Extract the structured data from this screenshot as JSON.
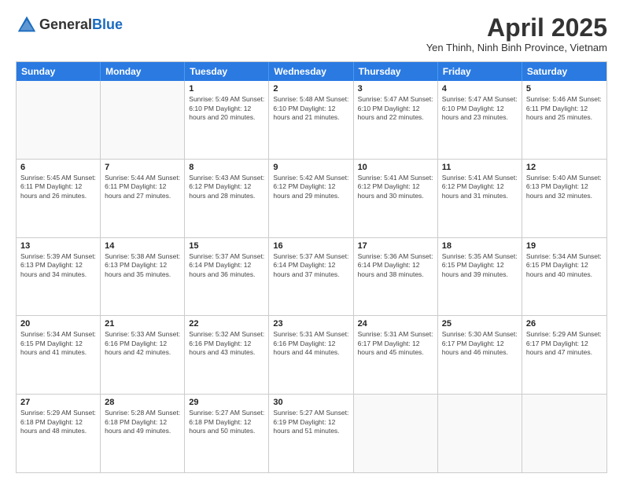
{
  "header": {
    "logo_line1": "General",
    "logo_line2": "Blue",
    "title": "April 2025",
    "location": "Yen Thinh, Ninh Binh Province, Vietnam"
  },
  "days_of_week": [
    "Sunday",
    "Monday",
    "Tuesday",
    "Wednesday",
    "Thursday",
    "Friday",
    "Saturday"
  ],
  "weeks": [
    [
      {
        "day": "",
        "info": ""
      },
      {
        "day": "",
        "info": ""
      },
      {
        "day": "1",
        "info": "Sunrise: 5:49 AM\nSunset: 6:10 PM\nDaylight: 12 hours and 20 minutes."
      },
      {
        "day": "2",
        "info": "Sunrise: 5:48 AM\nSunset: 6:10 PM\nDaylight: 12 hours and 21 minutes."
      },
      {
        "day": "3",
        "info": "Sunrise: 5:47 AM\nSunset: 6:10 PM\nDaylight: 12 hours and 22 minutes."
      },
      {
        "day": "4",
        "info": "Sunrise: 5:47 AM\nSunset: 6:10 PM\nDaylight: 12 hours and 23 minutes."
      },
      {
        "day": "5",
        "info": "Sunrise: 5:46 AM\nSunset: 6:11 PM\nDaylight: 12 hours and 25 minutes."
      }
    ],
    [
      {
        "day": "6",
        "info": "Sunrise: 5:45 AM\nSunset: 6:11 PM\nDaylight: 12 hours and 26 minutes."
      },
      {
        "day": "7",
        "info": "Sunrise: 5:44 AM\nSunset: 6:11 PM\nDaylight: 12 hours and 27 minutes."
      },
      {
        "day": "8",
        "info": "Sunrise: 5:43 AM\nSunset: 6:12 PM\nDaylight: 12 hours and 28 minutes."
      },
      {
        "day": "9",
        "info": "Sunrise: 5:42 AM\nSunset: 6:12 PM\nDaylight: 12 hours and 29 minutes."
      },
      {
        "day": "10",
        "info": "Sunrise: 5:41 AM\nSunset: 6:12 PM\nDaylight: 12 hours and 30 minutes."
      },
      {
        "day": "11",
        "info": "Sunrise: 5:41 AM\nSunset: 6:12 PM\nDaylight: 12 hours and 31 minutes."
      },
      {
        "day": "12",
        "info": "Sunrise: 5:40 AM\nSunset: 6:13 PM\nDaylight: 12 hours and 32 minutes."
      }
    ],
    [
      {
        "day": "13",
        "info": "Sunrise: 5:39 AM\nSunset: 6:13 PM\nDaylight: 12 hours and 34 minutes."
      },
      {
        "day": "14",
        "info": "Sunrise: 5:38 AM\nSunset: 6:13 PM\nDaylight: 12 hours and 35 minutes."
      },
      {
        "day": "15",
        "info": "Sunrise: 5:37 AM\nSunset: 6:14 PM\nDaylight: 12 hours and 36 minutes."
      },
      {
        "day": "16",
        "info": "Sunrise: 5:37 AM\nSunset: 6:14 PM\nDaylight: 12 hours and 37 minutes."
      },
      {
        "day": "17",
        "info": "Sunrise: 5:36 AM\nSunset: 6:14 PM\nDaylight: 12 hours and 38 minutes."
      },
      {
        "day": "18",
        "info": "Sunrise: 5:35 AM\nSunset: 6:15 PM\nDaylight: 12 hours and 39 minutes."
      },
      {
        "day": "19",
        "info": "Sunrise: 5:34 AM\nSunset: 6:15 PM\nDaylight: 12 hours and 40 minutes."
      }
    ],
    [
      {
        "day": "20",
        "info": "Sunrise: 5:34 AM\nSunset: 6:15 PM\nDaylight: 12 hours and 41 minutes."
      },
      {
        "day": "21",
        "info": "Sunrise: 5:33 AM\nSunset: 6:16 PM\nDaylight: 12 hours and 42 minutes."
      },
      {
        "day": "22",
        "info": "Sunrise: 5:32 AM\nSunset: 6:16 PM\nDaylight: 12 hours and 43 minutes."
      },
      {
        "day": "23",
        "info": "Sunrise: 5:31 AM\nSunset: 6:16 PM\nDaylight: 12 hours and 44 minutes."
      },
      {
        "day": "24",
        "info": "Sunrise: 5:31 AM\nSunset: 6:17 PM\nDaylight: 12 hours and 45 minutes."
      },
      {
        "day": "25",
        "info": "Sunrise: 5:30 AM\nSunset: 6:17 PM\nDaylight: 12 hours and 46 minutes."
      },
      {
        "day": "26",
        "info": "Sunrise: 5:29 AM\nSunset: 6:17 PM\nDaylight: 12 hours and 47 minutes."
      }
    ],
    [
      {
        "day": "27",
        "info": "Sunrise: 5:29 AM\nSunset: 6:18 PM\nDaylight: 12 hours and 48 minutes."
      },
      {
        "day": "28",
        "info": "Sunrise: 5:28 AM\nSunset: 6:18 PM\nDaylight: 12 hours and 49 minutes."
      },
      {
        "day": "29",
        "info": "Sunrise: 5:27 AM\nSunset: 6:18 PM\nDaylight: 12 hours and 50 minutes."
      },
      {
        "day": "30",
        "info": "Sunrise: 5:27 AM\nSunset: 6:19 PM\nDaylight: 12 hours and 51 minutes."
      },
      {
        "day": "",
        "info": ""
      },
      {
        "day": "",
        "info": ""
      },
      {
        "day": "",
        "info": ""
      }
    ]
  ]
}
